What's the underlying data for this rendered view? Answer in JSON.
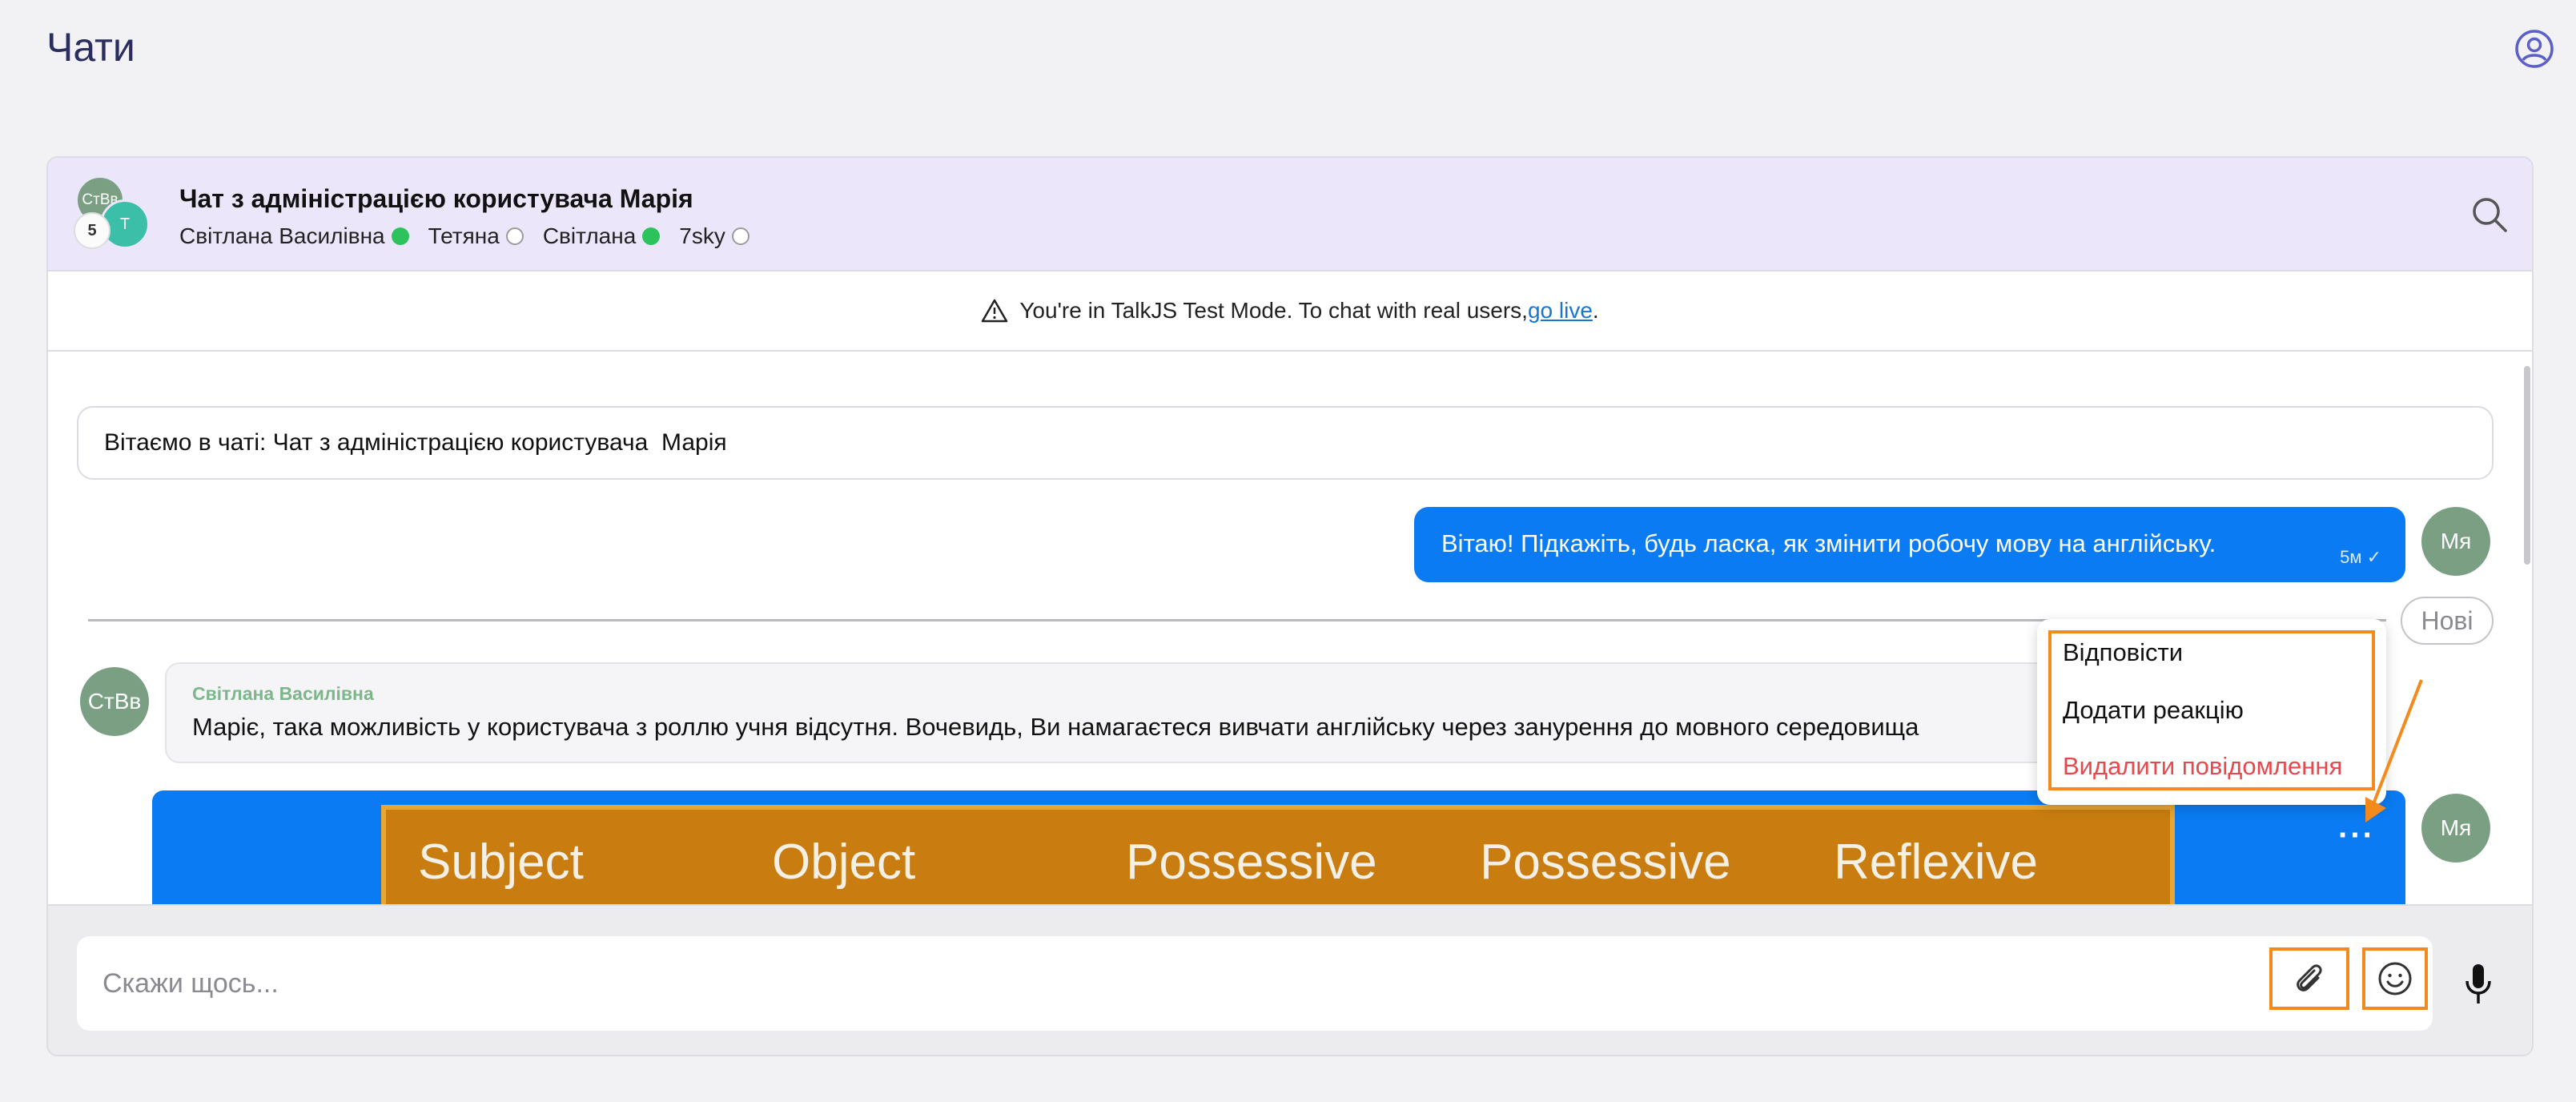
{
  "page": {
    "title": "Чати"
  },
  "header": {
    "avatar_1": "СтВв",
    "avatar_2": "Т",
    "avatar_count": "5",
    "chat_title": "Чат з адміністрацією користувача Марія",
    "participants": [
      {
        "name": "Світлана Василівна",
        "status": "online"
      },
      {
        "name": "Тетяна",
        "status": "offline"
      },
      {
        "name": "Світлана",
        "status": "online"
      },
      {
        "name": "7sky",
        "status": "offline"
      }
    ]
  },
  "banner": {
    "text": "You're in TalkJS Test Mode. To chat with real users, ",
    "link": "go live",
    "suffix": "."
  },
  "messages": {
    "welcome": "Вітаємо в чаті: Чат з адміністрацією користувача  Марія",
    "outgoing_text": "Вітаю! Підкажіть, будь ласка, як змінити робочу мову на англійську.",
    "outgoing_time": "5м ✓",
    "me_avatar": "Мя",
    "new_label": "Нові",
    "incoming_avatar": "СтВв",
    "incoming_sender": "Світлана Василівна",
    "incoming_text": "Маріє, така можливість у користувача з роллю учня відсутня. Вочевидь, Ви намагаєтеся вивчати англійську через занурення до мовного середовища",
    "image_headers": [
      "Subject",
      "Object",
      "Possessive",
      "Possessive",
      "Reflexive"
    ],
    "more_label": "···"
  },
  "context_menu": {
    "reply": "Відповісти",
    "react": "Додати реакцію",
    "delete": "Видалити повідомлення"
  },
  "composer": {
    "placeholder": "Скажи щось..."
  },
  "colors": {
    "accent": "#0a7bf2",
    "highlight": "#f28a1d",
    "header_bg": "#ece6fb",
    "online": "#2cc35d",
    "delete": "#e5484d"
  },
  "icons": [
    "user-circle-icon",
    "search-icon",
    "warning-icon",
    "paperclip-icon",
    "emoji-icon",
    "microphone-icon",
    "arrow-icon"
  ]
}
